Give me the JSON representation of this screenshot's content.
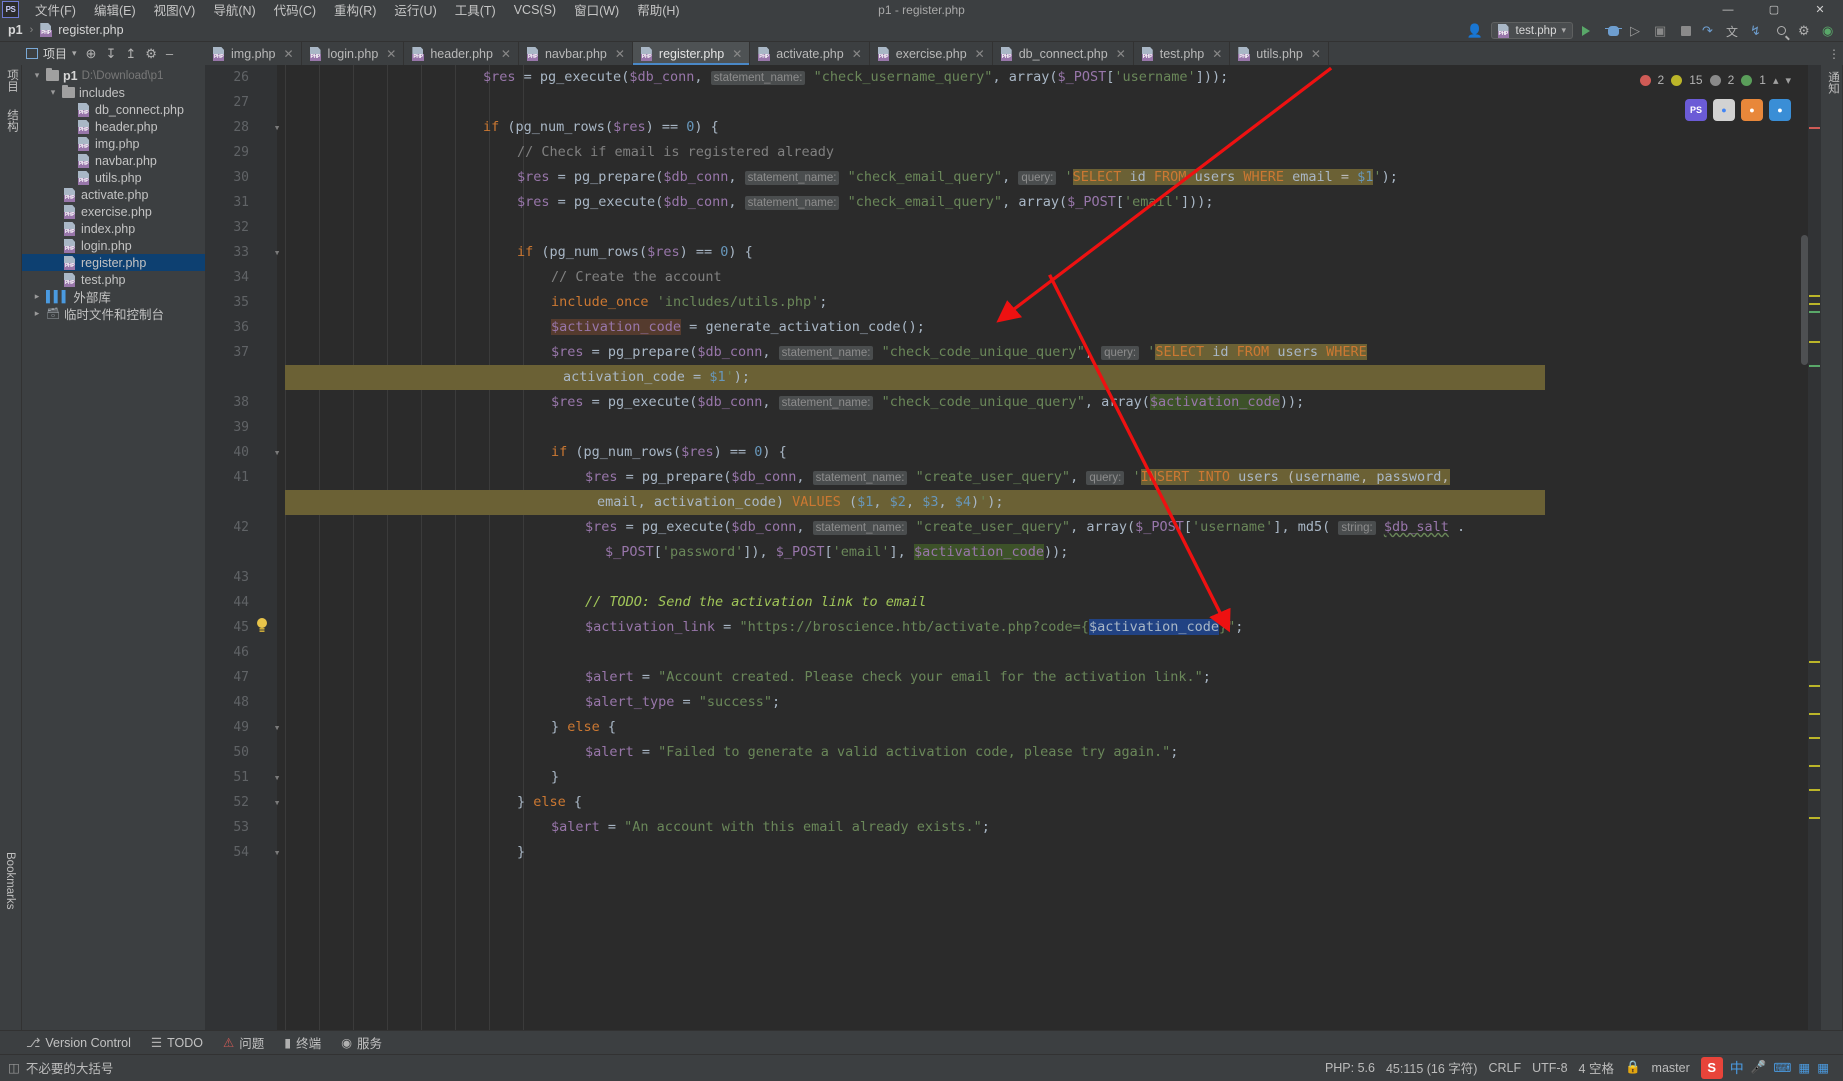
{
  "window": {
    "title": "p1 - register.php",
    "app_badge": "PS",
    "controls": {
      "minimize": "—",
      "maximize": "▢",
      "close": "✕"
    }
  },
  "menu": [
    "文件(F)",
    "编辑(E)",
    "视图(V)",
    "导航(N)",
    "代码(C)",
    "重构(R)",
    "运行(U)",
    "工具(T)",
    "VCS(S)",
    "窗口(W)",
    "帮助(H)"
  ],
  "breadcrumb": {
    "project": "p1",
    "separator": "›",
    "file": "register.php"
  },
  "nav_right": {
    "user_icon": "user-icon",
    "run_config": "test.php",
    "run_label": "run-icon",
    "debug_label": "debug-icon",
    "stop_label": "stop-icon",
    "search_label": "search-icon",
    "settings_label": "settings-icon",
    "translate_label": "translate-icon",
    "notify_label": "notification-icon"
  },
  "toolbar": {
    "project_label": "项目",
    "dropdown": "▾",
    "locate_icon": "locate-icon",
    "expand_icon": "expand-all-icon",
    "collapse_icon": "collapse-all-icon",
    "settings_icon": "gear-icon",
    "hide_icon": "hide-icon"
  },
  "left_strip": [
    "项目",
    "结构"
  ],
  "right_strip": [
    "通知"
  ],
  "bottom_strip": [
    "Bookmarks"
  ],
  "tabs": [
    {
      "label": "img.php",
      "active": false
    },
    {
      "label": "login.php",
      "active": false
    },
    {
      "label": "header.php",
      "active": false
    },
    {
      "label": "navbar.php",
      "active": false
    },
    {
      "label": "register.php",
      "active": true
    },
    {
      "label": "activate.php",
      "active": false
    },
    {
      "label": "exercise.php",
      "active": false
    },
    {
      "label": "db_connect.php",
      "active": false
    },
    {
      "label": "test.php",
      "active": false
    },
    {
      "label": "utils.php",
      "active": false
    }
  ],
  "project_tree": [
    {
      "depth": 0,
      "arrow": "v",
      "kind": "folder",
      "label": "p1",
      "extra": "D:\\Download\\p1",
      "selected": false,
      "bold": true
    },
    {
      "depth": 1,
      "arrow": "v",
      "kind": "folder",
      "label": "includes",
      "extra": "",
      "selected": false,
      "bold": false
    },
    {
      "depth": 2,
      "arrow": "",
      "kind": "php",
      "label": "db_connect.php",
      "extra": "",
      "selected": false,
      "bold": false
    },
    {
      "depth": 2,
      "arrow": "",
      "kind": "php",
      "label": "header.php",
      "extra": "",
      "selected": false,
      "bold": false
    },
    {
      "depth": 2,
      "arrow": "",
      "kind": "php",
      "label": "img.php",
      "extra": "",
      "selected": false,
      "bold": false
    },
    {
      "depth": 2,
      "arrow": "",
      "kind": "php",
      "label": "navbar.php",
      "extra": "",
      "selected": false,
      "bold": false
    },
    {
      "depth": 2,
      "arrow": "",
      "kind": "php",
      "label": "utils.php",
      "extra": "",
      "selected": false,
      "bold": false
    },
    {
      "depth": 1,
      "arrow": "",
      "kind": "php",
      "label": "activate.php",
      "extra": "",
      "selected": false,
      "bold": false
    },
    {
      "depth": 1,
      "arrow": "",
      "kind": "php",
      "label": "exercise.php",
      "extra": "",
      "selected": false,
      "bold": false
    },
    {
      "depth": 1,
      "arrow": "",
      "kind": "php",
      "label": "index.php",
      "extra": "",
      "selected": false,
      "bold": false
    },
    {
      "depth": 1,
      "arrow": "",
      "kind": "php",
      "label": "login.php",
      "extra": "",
      "selected": false,
      "bold": false
    },
    {
      "depth": 1,
      "arrow": "",
      "kind": "php",
      "label": "register.php",
      "extra": "",
      "selected": true,
      "bold": false
    },
    {
      "depth": 1,
      "arrow": "",
      "kind": "php",
      "label": "test.php",
      "extra": "",
      "selected": false,
      "bold": false
    },
    {
      "depth": 0,
      "arrow": ">",
      "kind": "lib",
      "label": "外部库",
      "extra": "",
      "selected": false,
      "bold": false
    },
    {
      "depth": 0,
      "arrow": ">",
      "kind": "scratch",
      "label": "临时文件和控制台",
      "extra": "",
      "selected": false,
      "bold": false
    }
  ],
  "inspection": {
    "errors": "2",
    "warnings": "15",
    "weak_warnings": "2",
    "typos": "1",
    "chevron_up": "⌃",
    "chevron_down": "⌄"
  },
  "editor": {
    "first_line": 26,
    "lines": [
      {
        "n": "26",
        "fold": "",
        "indent": 0
      },
      {
        "n": "27",
        "fold": "",
        "indent": 0
      },
      {
        "n": "28",
        "fold": "-",
        "indent": 0
      },
      {
        "n": "29",
        "fold": "",
        "indent": 0
      },
      {
        "n": "30",
        "fold": "",
        "indent": 0
      },
      {
        "n": "31",
        "fold": "",
        "indent": 0
      },
      {
        "n": "32",
        "fold": "",
        "indent": 0
      },
      {
        "n": "33",
        "fold": "-",
        "indent": 0
      },
      {
        "n": "34",
        "fold": "",
        "indent": 0
      },
      {
        "n": "35",
        "fold": "",
        "indent": 0
      },
      {
        "n": "36",
        "fold": "",
        "indent": 0
      },
      {
        "n": "37",
        "fold": "",
        "indent": 0
      },
      {
        "n": "38",
        "fold": "",
        "indent": 0
      },
      {
        "n": "39",
        "fold": "",
        "indent": 0
      },
      {
        "n": "40",
        "fold": "-",
        "indent": 0
      },
      {
        "n": "41",
        "fold": "",
        "indent": 0
      },
      {
        "n": "42",
        "fold": "",
        "indent": 0
      },
      {
        "n": "43",
        "fold": "",
        "indent": 0
      },
      {
        "n": "44",
        "fold": "",
        "indent": 0
      },
      {
        "n": "45",
        "fold": "",
        "indent": 0
      },
      {
        "n": "46",
        "fold": "",
        "indent": 0
      },
      {
        "n": "47",
        "fold": "",
        "indent": 0
      },
      {
        "n": "48",
        "fold": "",
        "indent": 0
      },
      {
        "n": "49",
        "fold": "-",
        "indent": 0
      },
      {
        "n": "50",
        "fold": "",
        "indent": 0
      },
      {
        "n": "51",
        "fold": "-",
        "indent": 0
      },
      {
        "n": "52",
        "fold": "-",
        "indent": 0
      },
      {
        "n": "53",
        "fold": "",
        "indent": 0
      },
      {
        "n": "54",
        "fold": "-",
        "indent": 0
      }
    ],
    "source_text": [
      "$res = pg_execute($db_conn, statement_name: \"check_username_query\", array($_POST['username']));",
      "",
      "if (pg_num_rows($res) == 0) {",
      "    // Check if email is registered already",
      "    $res = pg_prepare($db_conn, statement_name: \"check_email_query\", query: 'SELECT id FROM users WHERE email = $1');",
      "    $res = pg_execute($db_conn, statement_name: \"check_email_query\", array($_POST['email']));",
      "",
      "    if (pg_num_rows($res) == 0) {",
      "        // Create the account",
      "        include_once 'includes/utils.php';",
      "        $activation_code = generate_activation_code();",
      "        $res = pg_prepare($db_conn, statement_name: \"check_code_unique_query\", query: 'SELECT id FROM users WHERE activation_code = $1');",
      "        $res = pg_execute($db_conn, statement_name: \"check_code_unique_query\", array($activation_code));",
      "",
      "        if (pg_num_rows($res) == 0) {",
      "            $res = pg_prepare($db_conn, statement_name: \"create_user_query\", query: 'INSERT INTO users (username, password, email, activation_code) VALUES ($1, $2, $3, $4)');",
      "            $res = pg_execute($db_conn, statement_name: \"create_user_query\", array($_POST['username'], md5( string: $db_salt . $_POST['password']), $_POST['email'], $activation_code));",
      "",
      "            // TODO: Send the activation link to email",
      "            $activation_link = \"https://broscience.htb/activate.php?code={$activation_code}\";",
      "",
      "            $alert = \"Account created. Please check your email for the activation link.\";",
      "            $alert_type = \"success\";",
      "        } else {",
      "            $alert = \"Failed to generate a valid activation code, please try again.\";",
      "        }",
      "    } else {",
      "        $alert = \"An account with this email already exists.\";",
      "    }"
    ]
  },
  "bottom_tools": [
    {
      "icon": "branch-icon",
      "label": "Version Control"
    },
    {
      "icon": "todo-icon",
      "label": "TODO"
    },
    {
      "icon": "problems-icon",
      "label": "问题"
    },
    {
      "icon": "terminal-icon",
      "label": "终端"
    },
    {
      "icon": "services-icon",
      "label": "服务"
    }
  ],
  "status": {
    "left_icon": "inspection-icon",
    "left_text": "不必要的大括号",
    "php_version": "PHP: 5.6",
    "caret": "45:115 (16 字符)",
    "line_sep": "CRLF",
    "encoding": "UTF-8",
    "indent": "4 空格",
    "branch": "master",
    "lock_icon": "lock-icon"
  },
  "tray": {
    "s_icon": "S",
    "ime": "中",
    "items": [
      "mic-icon",
      "keyboard-icon",
      "panel-icon",
      "apps-icon"
    ]
  },
  "colors": {
    "bg_editor": "#2b2b2b",
    "bg_chrome": "#3c3f41",
    "gutter": "#313335",
    "selection": "#214283",
    "sql_inject": "#6b6135",
    "accent_tab": "#4a88c7",
    "arrow_annotation": "#ee1111",
    "keyword": "#cc7832",
    "string": "#6a8759",
    "variable": "#9876aa",
    "function": "#ffc66d",
    "comment": "#808080",
    "todo": "#a1c659"
  }
}
